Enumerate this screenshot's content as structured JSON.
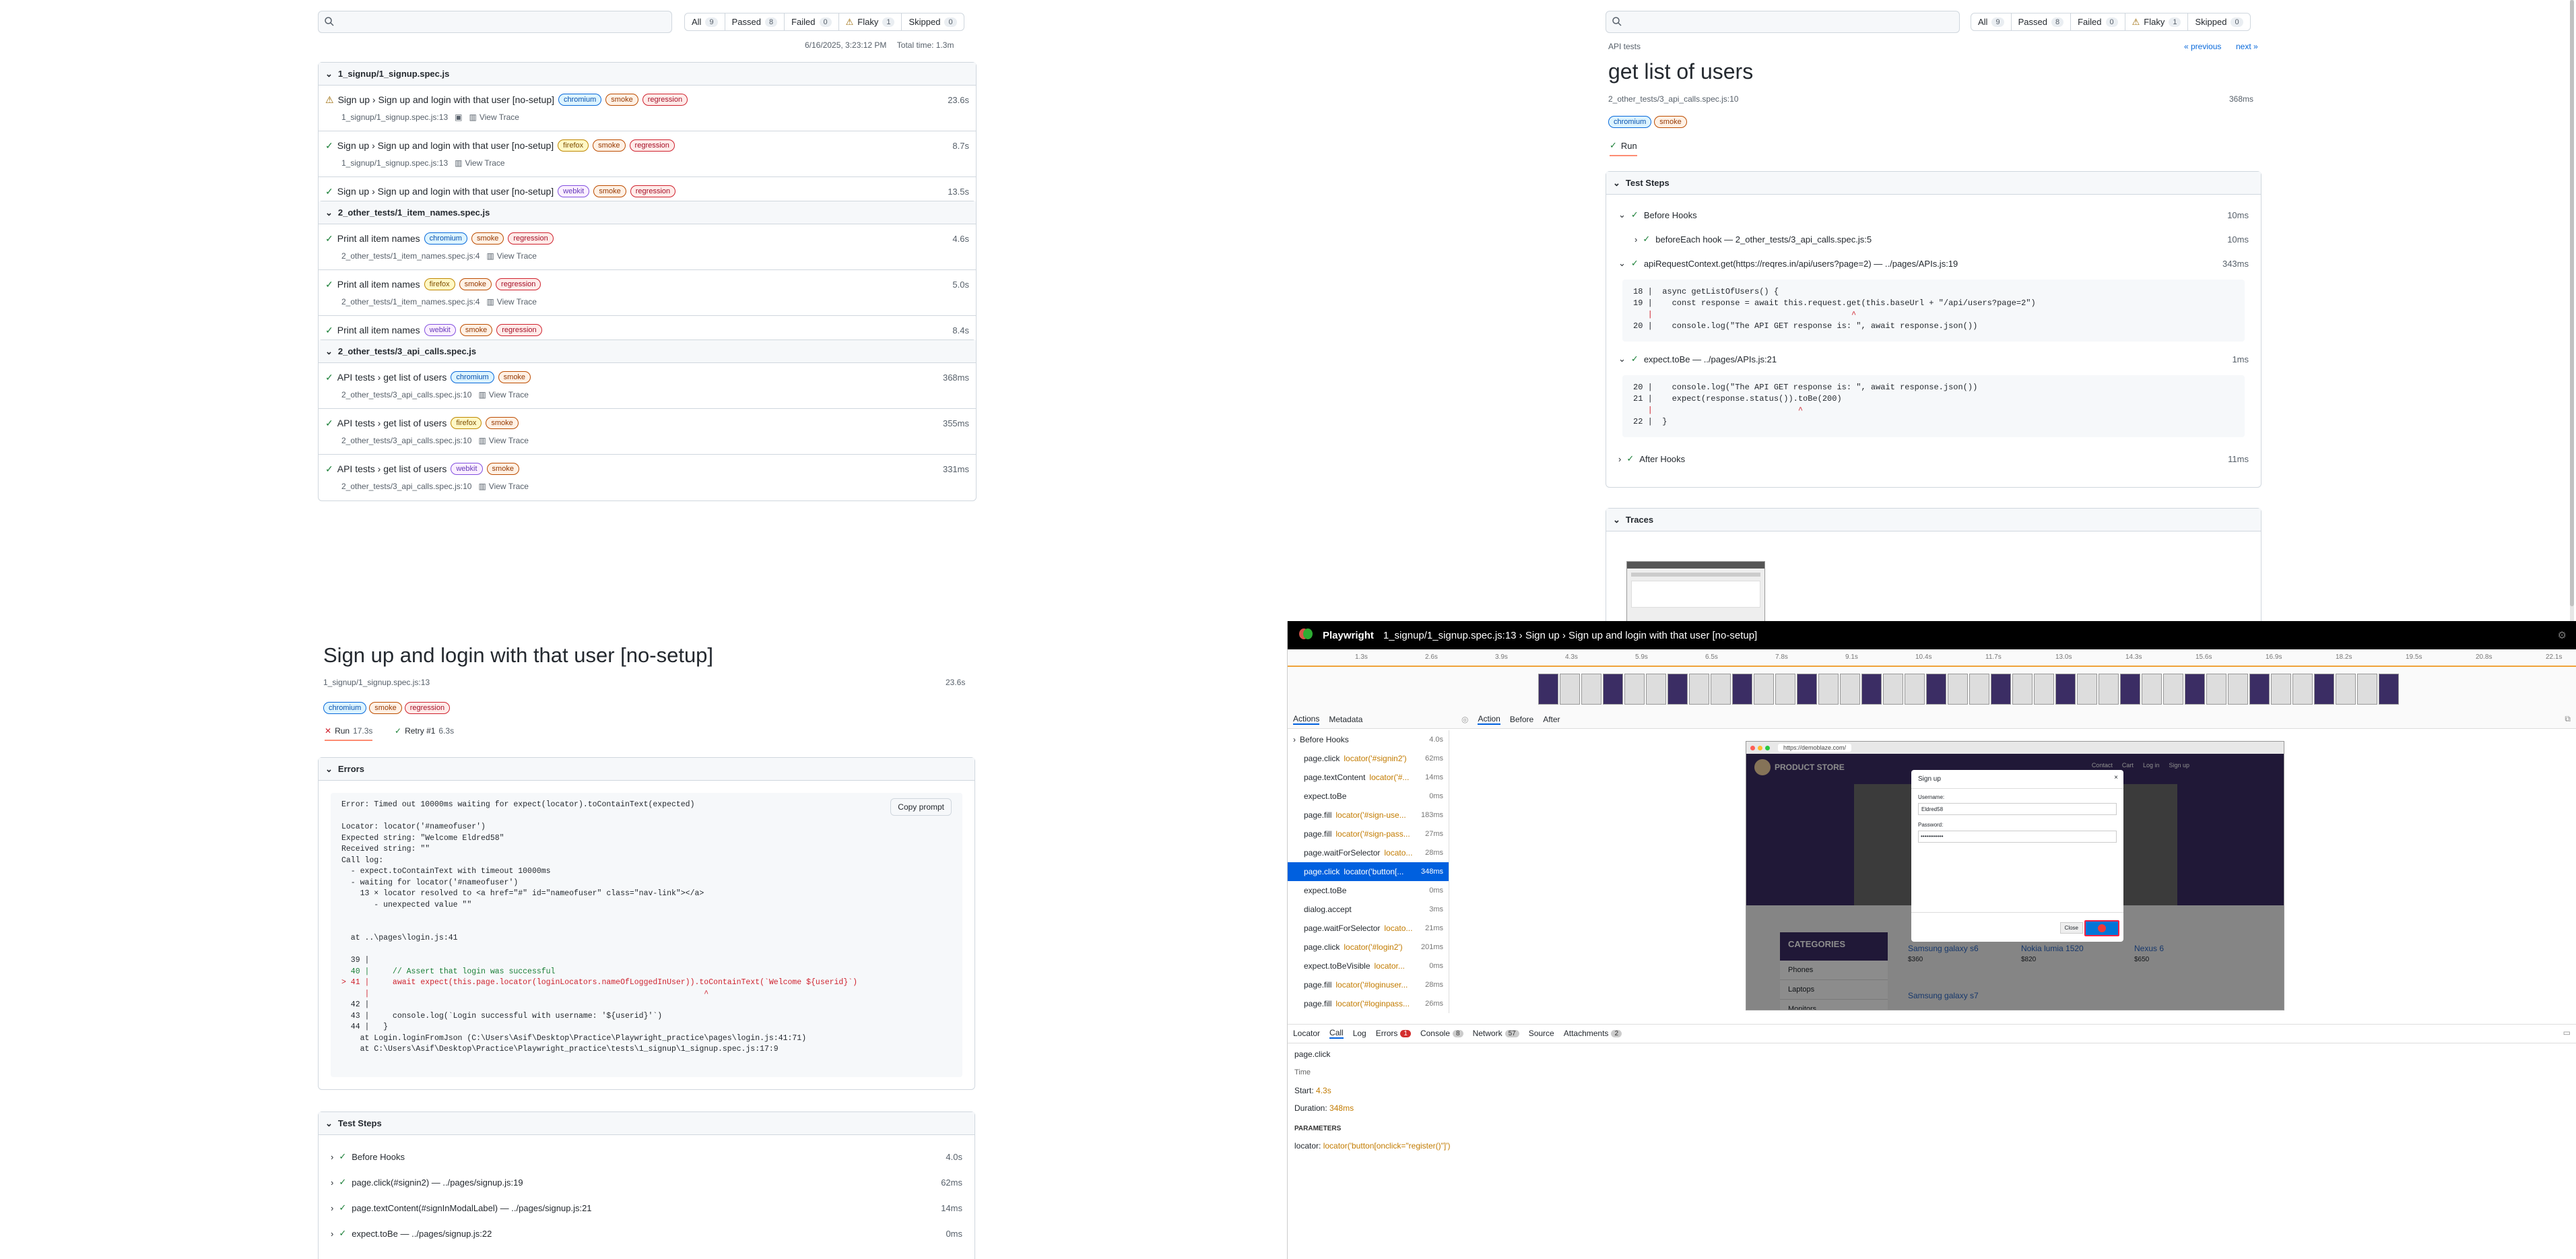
{
  "left_report": {
    "search": {
      "placeholder": ""
    },
    "filters": [
      {
        "label": "All",
        "count": "9"
      },
      {
        "label": "Passed",
        "count": "8"
      },
      {
        "label": "Failed",
        "count": "0"
      },
      {
        "label": "Flaky",
        "count": "1"
      },
      {
        "label": "Skipped",
        "count": "0"
      }
    ],
    "timestamp": "6/16/2025, 3:23:12 PM",
    "total_time": "Total time: 1.3m",
    "files": [
      {
        "name": "1_signup/1_signup.spec.js",
        "tests": [
          {
            "title": "Sign up › Sign up and login with that user [no-setup]",
            "status": "flaky",
            "tags": [
              "chromium",
              "smoke",
              "regression"
            ],
            "location": "1_signup/1_signup.spec.js:13",
            "trace": "View Trace",
            "duration": "23.6s"
          },
          {
            "title": "Sign up › Sign up and login with that user [no-setup]",
            "status": "passed",
            "tags": [
              "firefox",
              "smoke",
              "regression"
            ],
            "location": "1_signup/1_signup.spec.js:13",
            "trace": "View Trace",
            "duration": "8.7s"
          },
          {
            "title": "Sign up › Sign up and login with that user [no-setup]",
            "status": "passed",
            "tags": [
              "webkit",
              "smoke",
              "regression"
            ],
            "location": "1_signup/1_signup.spec.js:13",
            "trace": "View Trace",
            "duration": "13.5s"
          }
        ]
      },
      {
        "name": "2_other_tests/1_item_names.spec.js",
        "tests": [
          {
            "title": "Print all item names",
            "status": "passed",
            "tags": [
              "chromium",
              "smoke",
              "regression"
            ],
            "location": "2_other_tests/1_item_names.spec.js:4",
            "trace": "View Trace",
            "duration": "4.6s"
          },
          {
            "title": "Print all item names",
            "status": "passed",
            "tags": [
              "firefox",
              "smoke",
              "regression"
            ],
            "location": "2_other_tests/1_item_names.spec.js:4",
            "trace": "View Trace",
            "duration": "5.0s"
          },
          {
            "title": "Print all item names",
            "status": "passed",
            "tags": [
              "webkit",
              "smoke",
              "regression"
            ],
            "location": "2_other_tests/1_item_names.spec.js:4",
            "trace": "View Trace",
            "duration": "8.4s"
          }
        ]
      },
      {
        "name": "2_other_tests/3_api_calls.spec.js",
        "tests": [
          {
            "title": "API tests › get list of users",
            "status": "passed",
            "tags": [
              "chromium",
              "smoke"
            ],
            "location": "2_other_tests/3_api_calls.spec.js:10",
            "trace": "View Trace",
            "duration": "368ms"
          },
          {
            "title": "API tests › get list of users",
            "status": "passed",
            "tags": [
              "firefox",
              "smoke"
            ],
            "location": "2_other_tests/3_api_calls.spec.js:10",
            "trace": "View Trace",
            "duration": "355ms"
          },
          {
            "title": "API tests › get list of users",
            "status": "passed",
            "tags": [
              "webkit",
              "smoke"
            ],
            "location": "2_other_tests/3_api_calls.spec.js:10",
            "trace": "View Trace",
            "duration": "331ms"
          }
        ]
      }
    ]
  },
  "right_report": {
    "breadcrumb": "API tests",
    "prev": "« previous",
    "next": "next »",
    "title": "get list of users",
    "location": "2_other_tests/3_api_calls.spec.js:10",
    "duration": "368ms",
    "tags": [
      "chromium",
      "smoke"
    ],
    "run_tab": "Run",
    "test_steps_label": "Test Steps",
    "steps": [
      {
        "label": "Before Hooks",
        "dur": "10ms"
      },
      {
        "label": "beforeEach hook — 2_other_tests/3_api_calls.spec.js:5",
        "dur": "10ms"
      },
      {
        "label": "apiRequestContext.get(https://reqres.in/api/users?page=2) — ../pages/APIs.js:19",
        "dur": "343ms"
      },
      {
        "label": "expect.toBe — ../pages/APIs.js:21",
        "dur": "1ms"
      },
      {
        "label": "After Hooks",
        "dur": "11ms"
      }
    ],
    "code1": [
      "18 |  async getListOfUsers() {",
      "19 |    const response = await this.request.get(this.baseUrl + \"/api/users?page=2\")",
      "   |                                         ^",
      "20 |    console.log(\"The API GET response is: \", await response.json())"
    ],
    "code2": [
      "20 |    console.log(\"The API GET response is: \", await response.json())",
      "21 |    expect(response.status()).toBe(200)",
      "   |                              ^",
      "22 |  }"
    ],
    "traces_label": "Traces"
  },
  "left_detail": {
    "title": "Sign up and login with that user [no-setup]",
    "location": "1_signup/1_signup.spec.js:13",
    "duration": "23.6s",
    "tags": [
      "chromium",
      "smoke",
      "regression"
    ],
    "run_label": "Run",
    "run_dur": "17.3s",
    "retry_label": "Retry #1",
    "retry_dur": "6.3s",
    "errors_label": "Errors",
    "copy_prompt": "Copy prompt",
    "error_lines": [
      "Error: Timed out 10000ms waiting for expect(locator).toContainText(expected)",
      "",
      "Locator: locator('#nameofuser')",
      "Expected string: \"Welcome Eldred58\"",
      "Received string: \"\"",
      "Call log:",
      "  - expect.toContainText with timeout 10000ms",
      "  - waiting for locator('#nameofuser')",
      "    13 × locator resolved to <a href=\"#\" id=\"nameofuser\" class=\"nav-link\"></a>",
      "       - unexpected value \"\"",
      "",
      "",
      "  at ..\\pages\\login.js:41",
      "",
      "  39 |",
      "  40 |     // Assert that login was successful",
      "> 41 |     await expect(this.page.locator(loginLocators.nameOfLoggedInUser)).toContainText(`Welcome ${userid}`)",
      "     |                                                                        ^",
      "  42 |",
      "  43 |     console.log(`Login successful with username: '${userid}'`)",
      "  44 |   }",
      "    at Login.loginFromJson (C:\\Users\\Asif\\Desktop\\Practice\\Playwright_practice\\pages\\login.js:41:71)",
      "    at C:\\Users\\Asif\\Desktop\\Practice\\Playwright_practice\\tests\\1_signup\\1_signup.spec.js:17:9"
    ],
    "test_steps_label": "Test Steps",
    "steps": [
      {
        "label": "Before Hooks",
        "dur": "4.0s"
      },
      {
        "label": "page.click(#signin2) — ../pages/signup.js:19",
        "dur": "62ms"
      },
      {
        "label": "page.textContent(#signInModalLabel) — ../pages/signup.js:21",
        "dur": "14ms"
      },
      {
        "label": "expect.toBe — ../pages/signup.js:22",
        "dur": "0ms"
      }
    ]
  },
  "trace_viewer": {
    "app": "Playwright",
    "title": "1_signup/1_signup.spec.js:13 › Sign up › Sign up and login with that user [no-setup]",
    "ticks": [
      "1.3s",
      "2.6s",
      "3.9s",
      "4.3s",
      "5.9s",
      "6.5s",
      "7.8s",
      "9.1s",
      "10.4s",
      "11.7s",
      "13.0s",
      "14.3s",
      "15.6s",
      "16.9s",
      "18.2s",
      "19.5s",
      "20.8s",
      "22.1s"
    ],
    "left_tabs": [
      "Actions",
      "Metadata"
    ],
    "actions": [
      {
        "name": "Before Hooks",
        "loc": "",
        "dur": "4.0s",
        "kind": "group"
      },
      {
        "name": "page.click",
        "loc": "locator('#signin2')",
        "dur": "62ms",
        "kind": ""
      },
      {
        "name": "page.textContent",
        "loc": "locator('#...",
        "dur": "14ms",
        "kind": ""
      },
      {
        "name": "expect.toBe",
        "loc": "",
        "dur": "0ms",
        "kind": ""
      },
      {
        "name": "page.fill",
        "loc": "locator('#sign-use...",
        "dur": "183ms",
        "kind": ""
      },
      {
        "name": "page.fill",
        "loc": "locator('#sign-pass...",
        "dur": "27ms",
        "kind": ""
      },
      {
        "name": "page.waitForSelector",
        "loc": "locato...",
        "dur": "28ms",
        "kind": ""
      },
      {
        "name": "page.click",
        "loc": "locator('button[...",
        "dur": "348ms",
        "kind": "sel"
      },
      {
        "name": "expect.toBe",
        "loc": "",
        "dur": "0ms",
        "kind": ""
      },
      {
        "name": "dialog.accept",
        "loc": "",
        "dur": "3ms",
        "kind": ""
      },
      {
        "name": "page.waitForSelector",
        "loc": "locato...",
        "dur": "21ms",
        "kind": ""
      },
      {
        "name": "page.click",
        "loc": "locator('#login2')",
        "dur": "201ms",
        "kind": ""
      },
      {
        "name": "expect.toBeVisible",
        "loc": "locator...",
        "dur": "0ms",
        "kind": ""
      },
      {
        "name": "page.fill",
        "loc": "locator('#loginuser...",
        "dur": "28ms",
        "kind": ""
      },
      {
        "name": "page.fill",
        "loc": "locator('#loginpass...",
        "dur": "26ms",
        "kind": ""
      },
      {
        "name": "page.click",
        "loc": "locator('button[o...",
        "dur": "77ms",
        "kind": ""
      },
      {
        "name": "expect.toContainTe...",
        "loc": "",
        "dur": "10.0s",
        "kind": "err"
      },
      {
        "name": "After Hooks",
        "loc": "",
        "dur": "1.5s",
        "kind": "group"
      }
    ],
    "view_tabs": [
      "Action",
      "Before",
      "After"
    ],
    "browser_url": "https://demoblaze.com/",
    "store": {
      "brand": "PRODUCT STORE",
      "nav": [
        "Contact",
        "Cart",
        "Log in",
        "Sign up"
      ],
      "categories_label": "CATEGORIES",
      "categories": [
        "Phones",
        "Laptops",
        "Monitors"
      ],
      "products": [
        {
          "name": "Samsung galaxy s6",
          "price": "$360"
        },
        {
          "name": "Nokia lumia 1520",
          "price": "$820"
        },
        {
          "name": "Nexus 6",
          "price": "$650"
        }
      ],
      "more_product": "Samsung galaxy s7",
      "modal": {
        "title": "Sign up",
        "user_label": "Username:",
        "user_value": "Eldred58",
        "pass_label": "Password:",
        "pass_value": "••••••••••••",
        "close": "Close"
      }
    },
    "bottom_tabs": [
      {
        "label": "Locator",
        "badge": ""
      },
      {
        "label": "Call",
        "badge": ""
      },
      {
        "label": "Log",
        "badge": ""
      },
      {
        "label": "Errors",
        "badge": "1"
      },
      {
        "label": "Console",
        "badge": "8"
      },
      {
        "label": "Network",
        "badge": "57"
      },
      {
        "label": "Source",
        "badge": ""
      },
      {
        "label": "Attachments",
        "badge": "2"
      }
    ],
    "call": {
      "action": "page.click",
      "time_label": "Time",
      "start_label": "Start:",
      "start_value": "4.3s",
      "duration_label": "Duration:",
      "duration_value": "348ms",
      "params_label": "PARAMETERS",
      "locator_label": "locator:",
      "locator_value": "locator('button[onclick=\"register()\"]')"
    }
  }
}
